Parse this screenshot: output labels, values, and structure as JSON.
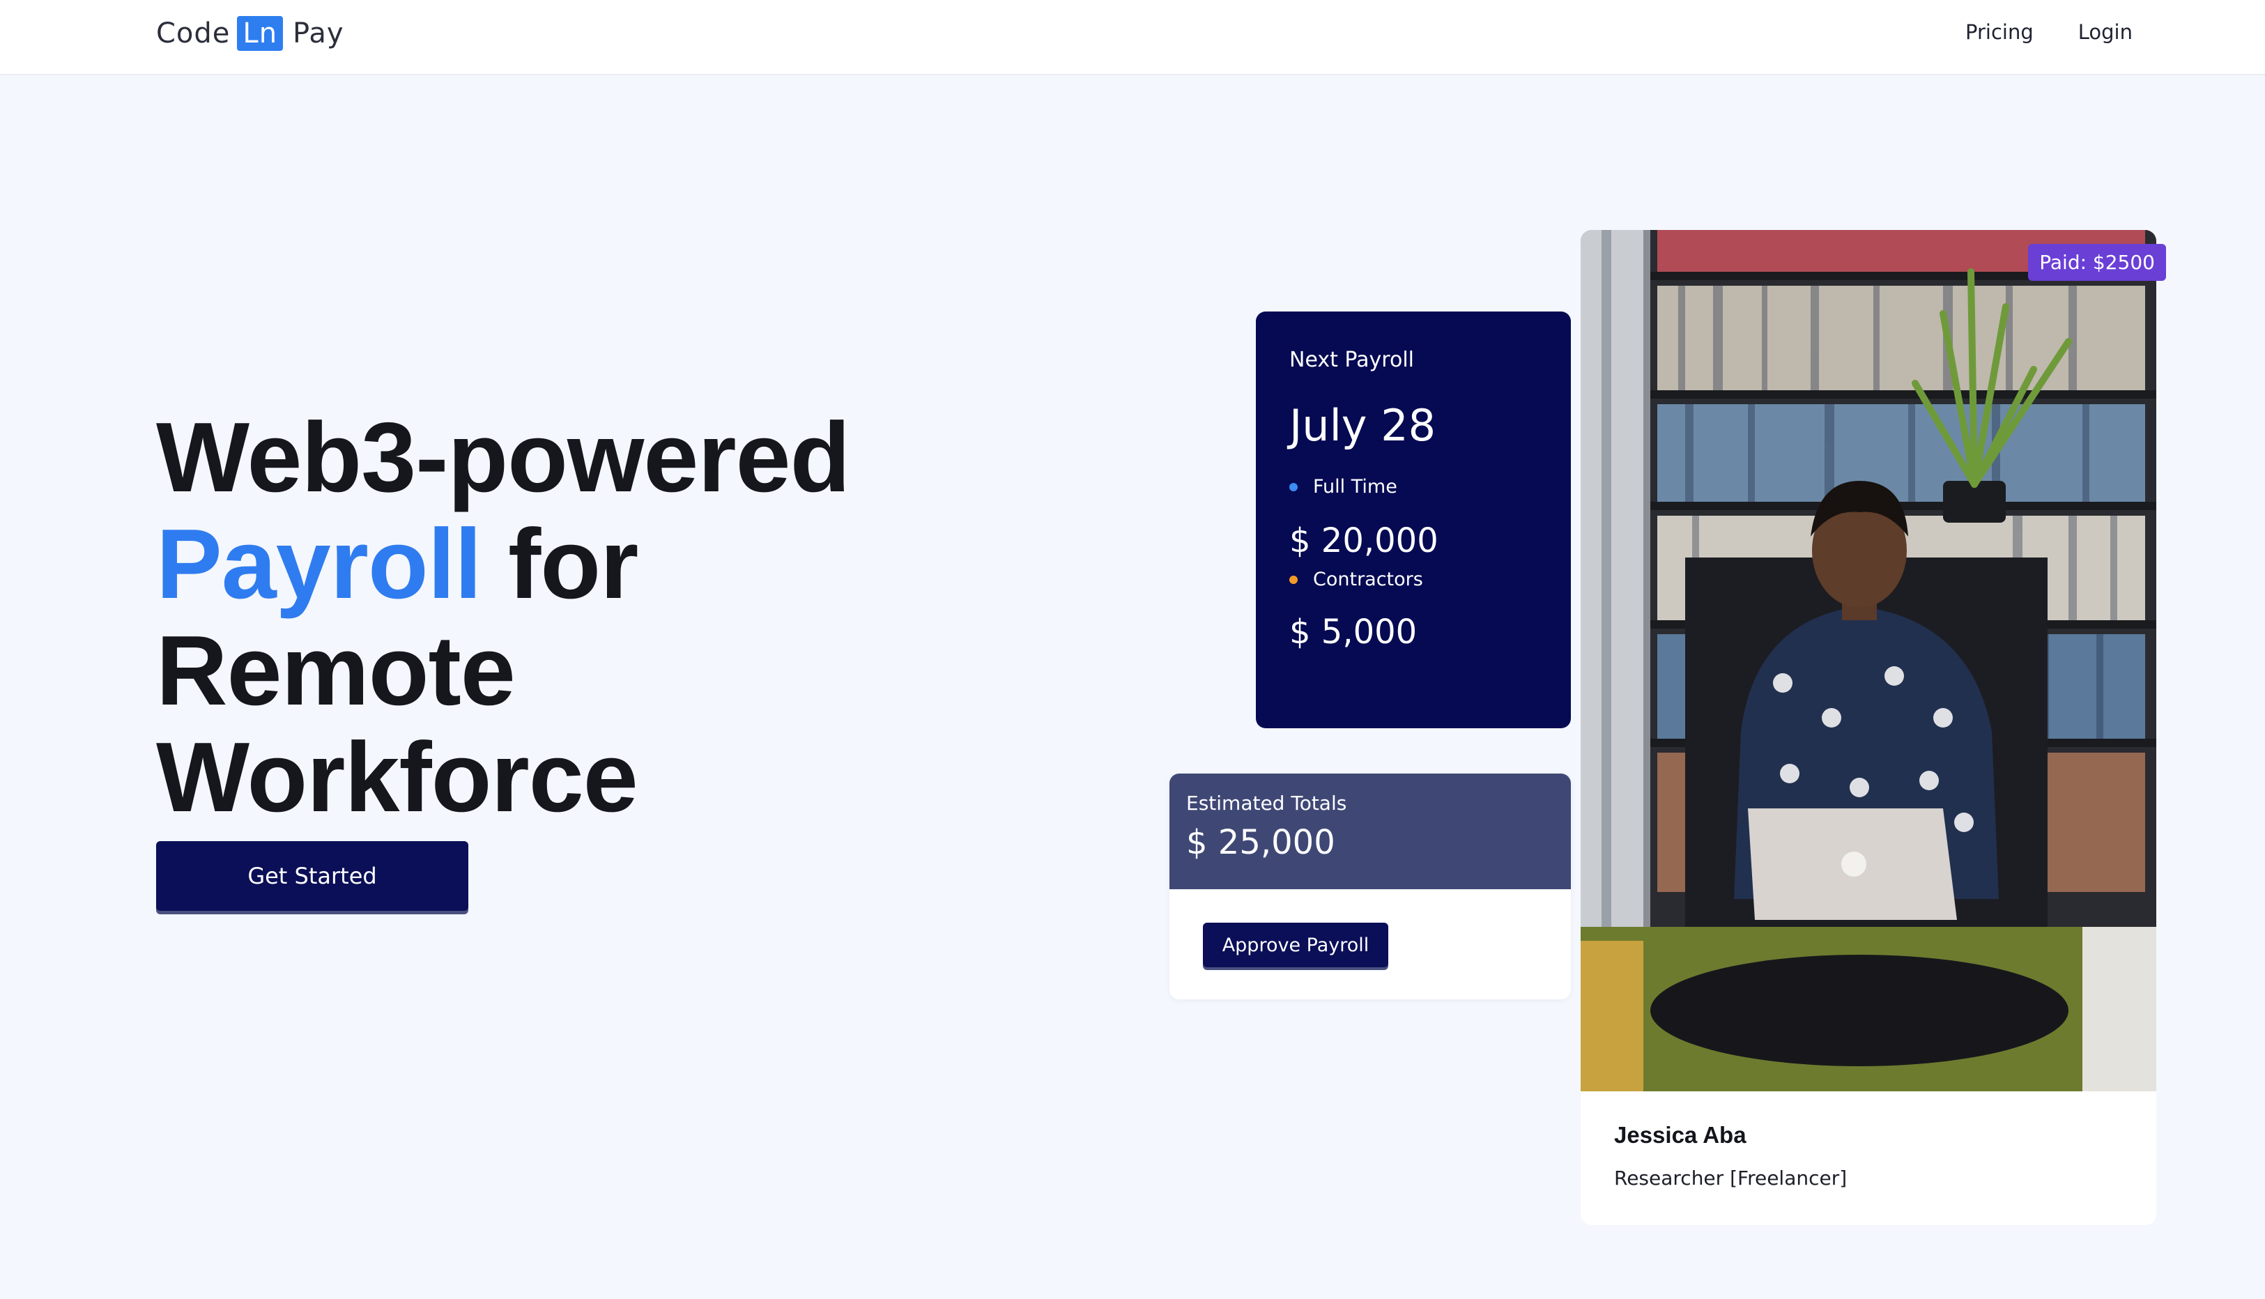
{
  "brand": {
    "name_left": "Code",
    "name_mid": "Ln",
    "name_right": "Pay"
  },
  "nav": {
    "pricing": "Pricing",
    "login": "Login"
  },
  "hero": {
    "line1": "Web3-powered",
    "line2_accent": "Payroll",
    "line2_rest": " for",
    "line3": "Remote",
    "line4": "Workforce",
    "cta": "Get Started"
  },
  "payroll": {
    "label": "Next Payroll",
    "date": "July 28",
    "full_time": {
      "label": "Full Time",
      "amount": "$ 20,000",
      "dot_color": "#3b8cf5"
    },
    "contractors": {
      "label": "Contractors",
      "amount": "$ 5,000",
      "dot_color": "#f39a2b"
    }
  },
  "totals": {
    "label": "Estimated Totals",
    "amount": "$ 25,000",
    "approve": "Approve Payroll"
  },
  "profile": {
    "badge": "Paid: $2500",
    "name": "Jessica Aba",
    "role": "Researcher [Freelancer]"
  },
  "colors": {
    "accent": "#2f7cf0",
    "navy": "#0b0f57",
    "badge": "#6a3fd6",
    "slate": "#3f4875"
  }
}
